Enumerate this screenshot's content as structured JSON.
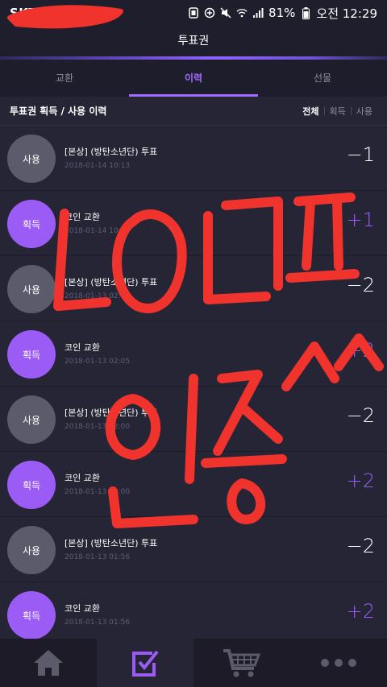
{
  "status_bar": {
    "carrier": "SKT",
    "battery": "81%",
    "time": "오전 12:29"
  },
  "header": {
    "title": "투표권"
  },
  "tabs": [
    {
      "label": "교환",
      "active": false
    },
    {
      "label": "이력",
      "active": true
    },
    {
      "label": "선물",
      "active": false
    }
  ],
  "subheader": {
    "title": "투표권 획득 / 사용 이력",
    "filters": [
      "전체",
      "획득",
      "사용"
    ],
    "active_filter": "전체"
  },
  "history": [
    {
      "type": "사용",
      "name": "[본상] (방탄소년단) 투표",
      "date": "2018-01-14 10:13",
      "amount": "−1"
    },
    {
      "type": "획득",
      "name": "코인 교환",
      "date": "2018-01-14 10:08",
      "amount": "+1"
    },
    {
      "type": "사용",
      "name": "[본상] (방탄소년단) 투표",
      "date": "2018-01-13 02:05",
      "amount": "−2"
    },
    {
      "type": "획득",
      "name": "코인 교환",
      "date": "2018-01-13 02:05",
      "amount": "+2"
    },
    {
      "type": "사용",
      "name": "[본상] (방탄소년단) 투표",
      "date": "2018-01-13 02:00",
      "amount": "−2"
    },
    {
      "type": "획득",
      "name": "코인 교환",
      "date": "2018-01-13 02:00",
      "amount": "+2"
    },
    {
      "type": "사용",
      "name": "[본상] (방탄소년단) 투표",
      "date": "2018-01-13 01:56",
      "amount": "−2"
    },
    {
      "type": "획득",
      "name": "코인 교환",
      "date": "2018-01-13 01:56",
      "amount": "+2"
    }
  ],
  "bottom_nav": [
    {
      "icon": "home-icon",
      "active": false
    },
    {
      "icon": "vote-check-icon",
      "active": true
    },
    {
      "icon": "cart-icon",
      "active": false
    },
    {
      "icon": "more-icon",
      "active": false
    }
  ],
  "colors": {
    "accent": "#9b5cf6",
    "background": "#262535",
    "bar": "#1f1e2c",
    "scribble": "#f0332c"
  }
}
